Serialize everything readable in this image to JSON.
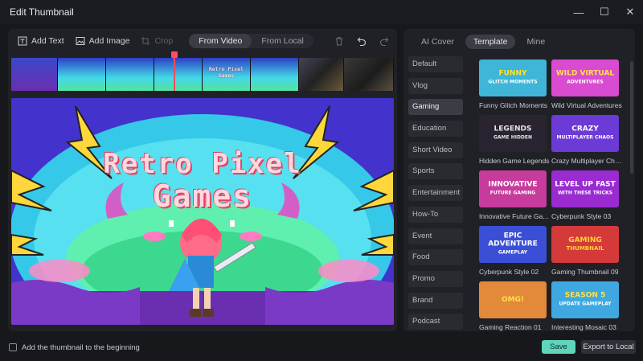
{
  "window": {
    "title": "Edit Thumbnail",
    "controls": {
      "minimize": "—",
      "maximize": "☐",
      "close": "✕"
    }
  },
  "toolbar": {
    "add_text": "Add Text",
    "add_image": "Add Image",
    "crop": "Crop",
    "source_options": [
      "From Video",
      "From Local"
    ],
    "active_source": "From Video",
    "icons": [
      "text-icon",
      "image-icon",
      "crop-icon",
      "trash-icon",
      "undo-icon",
      "redo-icon"
    ]
  },
  "filmstrip": {
    "frame_caption": "Retro Pixel Games"
  },
  "preview": {
    "title_line1": "Retro Pixel",
    "title_line2": "Games"
  },
  "right_panel": {
    "tabs": [
      "AI Cover",
      "Template",
      "Mine"
    ],
    "active_tab": "Template",
    "categories": [
      "Default",
      "Vlog",
      "Gaming",
      "Education",
      "Short Video",
      "Sports",
      "Entertainment",
      "How-To",
      "Event",
      "Food",
      "Promo",
      "Brand",
      "Podcast"
    ],
    "active_category": "Gaming",
    "templates": [
      {
        "name": "Funny Glitch Moments",
        "thumb_text": "FUNNY",
        "thumb_sub": "GLITCH MOMENTS",
        "bg": "#3fb6d8",
        "fg": "#ffe233"
      },
      {
        "name": "Wild Virtual Adventures",
        "thumb_text": "WILD VIRTUAL",
        "thumb_sub": "ADVENTURES",
        "bg": "#d94bd0",
        "fg": "#ffe34a"
      },
      {
        "name": "Hidden Game Legends",
        "thumb_text": "LEGENDS",
        "thumb_sub": "GAME HIDDEN",
        "bg": "#2a2430",
        "fg": "#e7e2ea"
      },
      {
        "name": "Crazy Multiplayer Chaos",
        "thumb_text": "CRAZY",
        "thumb_sub": "MULTIPLAYER CHAOS",
        "bg": "#6c3ad6",
        "fg": "#ffffff"
      },
      {
        "name": "Innovative Future Ga...",
        "thumb_text": "INNOVATIVE",
        "thumb_sub": "FUTURE GAMING",
        "bg": "#c73b9c",
        "fg": "#ffffff"
      },
      {
        "name": "Cyberpunk Style 03",
        "thumb_text": "LEVEL UP FAST",
        "thumb_sub": "WITH THESE TRICKS",
        "bg": "#9a2bd1",
        "fg": "#ffffff"
      },
      {
        "name": "Cyberpunk Style 02",
        "thumb_text": "EPIC ADVENTURE",
        "thumb_sub": "GAMEPLAY",
        "bg": "#3a4fd6",
        "fg": "#ffffff"
      },
      {
        "name": "Gaming Thumbnail 09",
        "thumb_text": "GAMING",
        "thumb_sub": "THUMBNAIL",
        "bg": "#d43a3a",
        "fg": "#ffd23a"
      },
      {
        "name": "Gaming Reaction 01",
        "thumb_text": "OMG!",
        "thumb_sub": "",
        "bg": "#e2893a",
        "fg": "#ffe14a"
      },
      {
        "name": "Interesting Mosaic 03",
        "thumb_text": "SEASON 5",
        "thumb_sub": "UPDATE GAMEPLAY",
        "bg": "#3fa8e0",
        "fg": "#ffe14a"
      }
    ]
  },
  "footer": {
    "checkbox_label": "Add the thumbnail to the beginning",
    "checkbox_checked": false,
    "save": "Save",
    "export": "Export to Local"
  }
}
